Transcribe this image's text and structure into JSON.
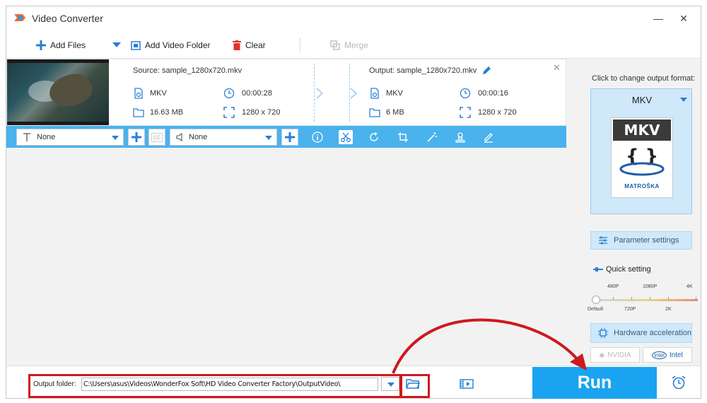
{
  "window": {
    "title": "Video Converter",
    "minimize_glyph": "—",
    "close_glyph": "✕"
  },
  "toolbar": {
    "add_files": "Add Files",
    "add_folder": "Add Video Folder",
    "clear": "Clear",
    "merge": "Merge"
  },
  "file": {
    "source_name": "Source: sample_1280x720.mkv",
    "output_name": "Output: sample_1280x720.mkv",
    "source": {
      "format": "MKV",
      "duration": "00:00:28",
      "size": "16.63 MB",
      "resolution": "1280 x 720"
    },
    "output": {
      "format": "MKV",
      "duration": "00:00:16",
      "size": "6 MB",
      "resolution": "1280 x 720"
    },
    "close_glyph": "✕"
  },
  "edit_bar": {
    "subtitle_value": "None",
    "audio_value": "None"
  },
  "right_panel": {
    "caption": "Click to change output format:",
    "format": "MKV",
    "card_top": "MKV",
    "card_bottom": "MATROŠKA",
    "parameter_settings": "Parameter settings",
    "quick_setting": "Quick setting",
    "ticks_top": [
      "480P",
      "1080P",
      "4K"
    ],
    "ticks_bottom": [
      "Default",
      "720P",
      "2K"
    ],
    "quick_setting_level": 0,
    "hardware_acceleration": "Hardware acceleration",
    "vendors": [
      "NVIDIA",
      "Intel"
    ]
  },
  "bottom": {
    "output_folder_label": "Output folder:",
    "output_folder_path": "C:\\Users\\asus\\Videos\\WonderFox Soft\\HD Video Converter Factory\\OutputVideo\\",
    "run": "Run"
  },
  "colors": {
    "accent": "#1aa3f0",
    "edit_bar": "#4ab2ec",
    "annotation_red": "#d0181f",
    "selected_format_bg": "#cfe8fa"
  }
}
